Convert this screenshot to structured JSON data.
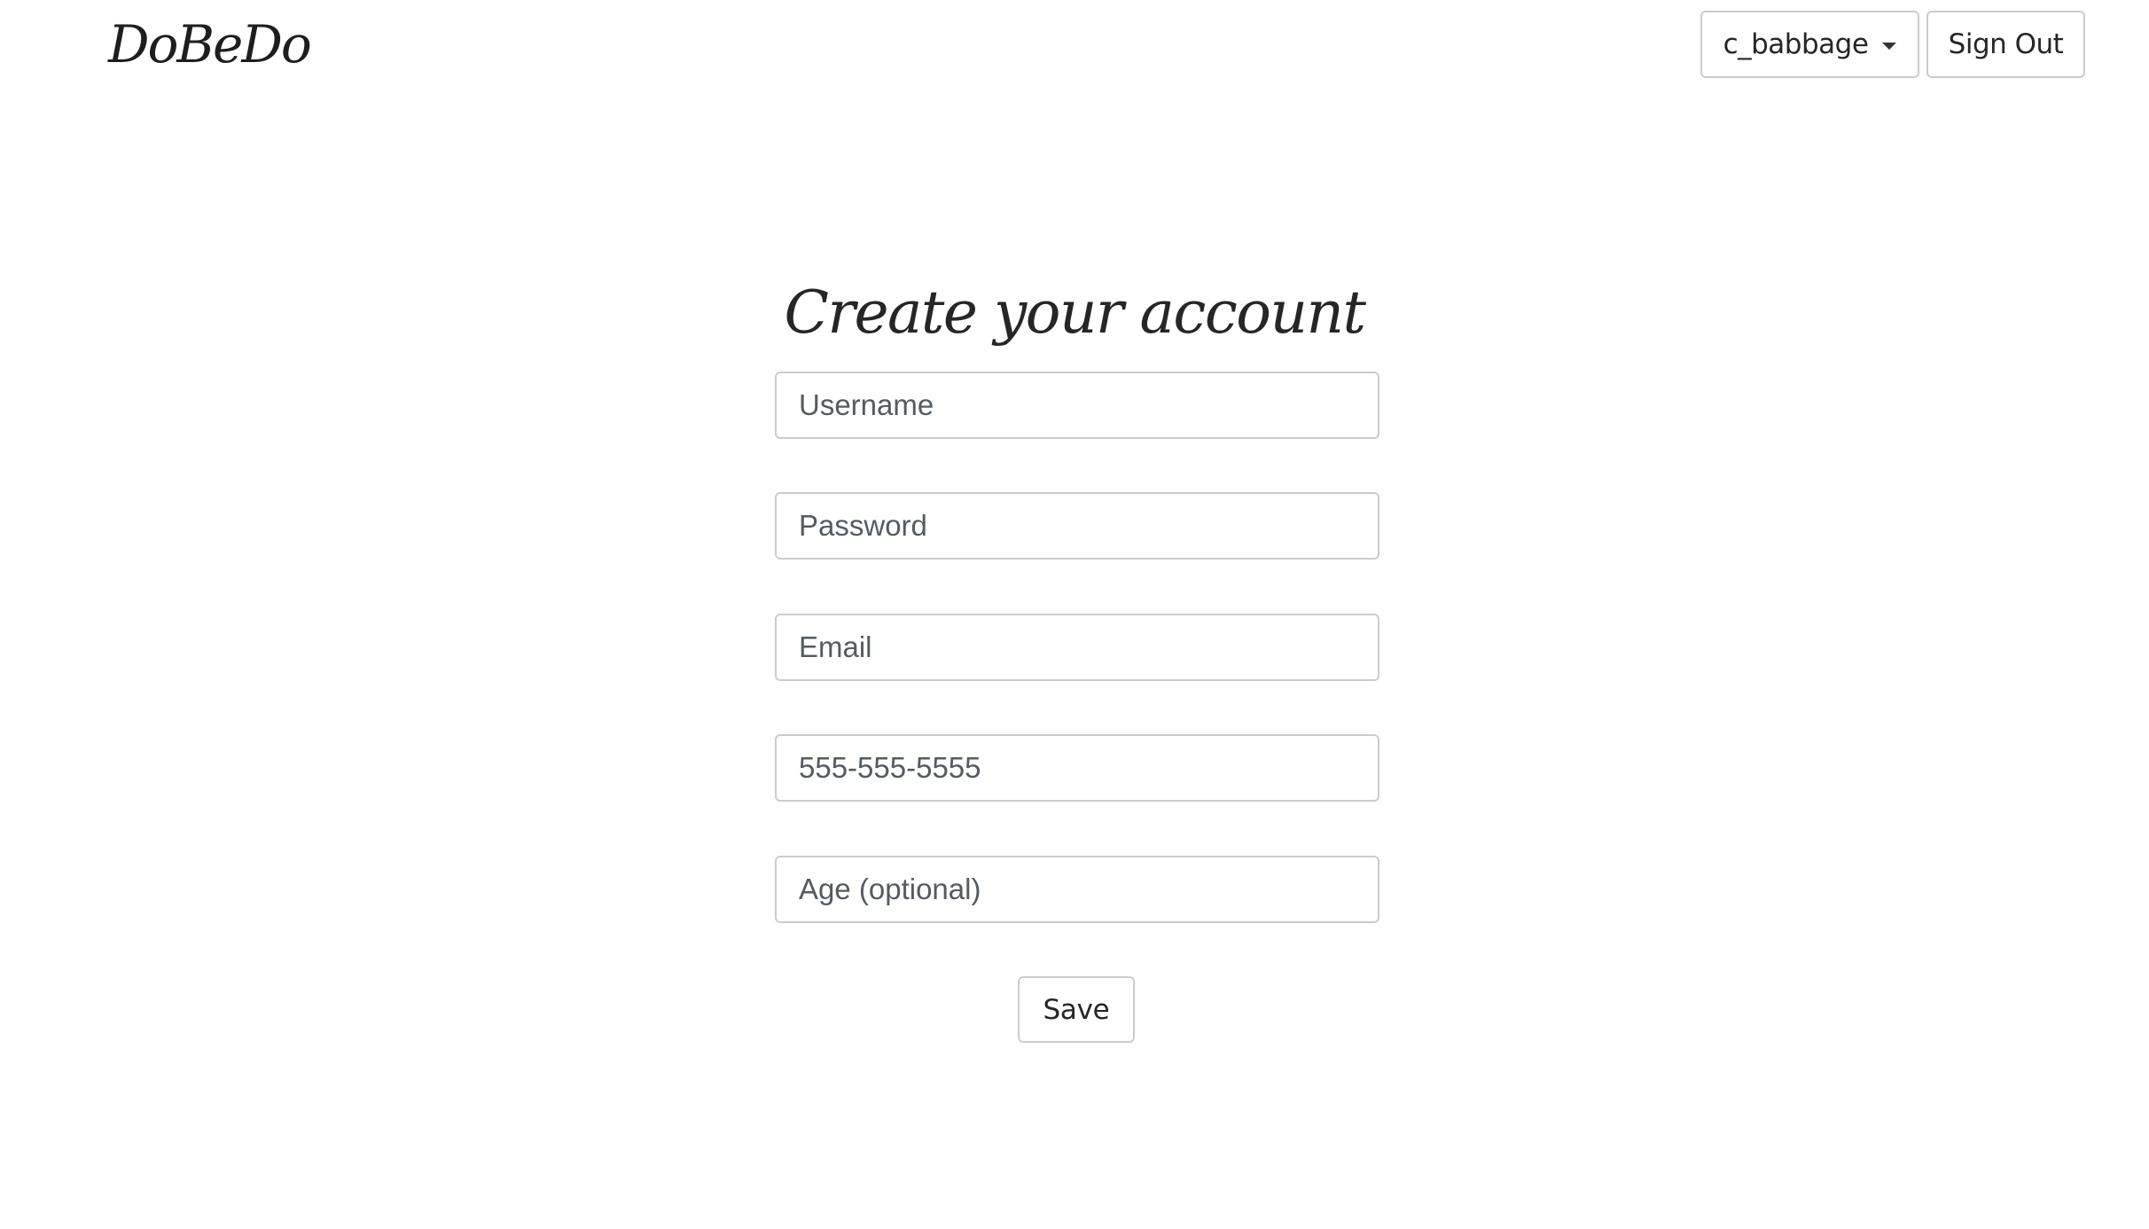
{
  "header": {
    "logo": "DoBeDo",
    "user_menu": {
      "label": "c_babbage",
      "icon": "caret-down-icon"
    },
    "sign_out_label": "Sign Out"
  },
  "form": {
    "title": "Create your account",
    "fields": [
      {
        "placeholder": "Username",
        "value": ""
      },
      {
        "placeholder": "Password",
        "value": ""
      },
      {
        "placeholder": "Email",
        "value": ""
      },
      {
        "placeholder": "555-555-5555",
        "value": ""
      },
      {
        "placeholder": "Age (optional)",
        "value": ""
      }
    ],
    "save_label": "Save"
  },
  "colors": {
    "background": "#ffffff",
    "border": "#cccccc",
    "text": "#222222",
    "placeholder": "#555b62"
  }
}
